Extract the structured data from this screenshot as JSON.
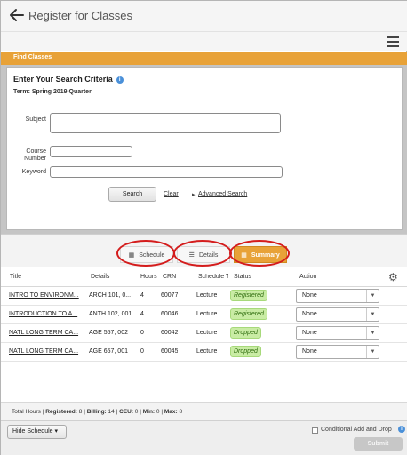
{
  "header": {
    "title": "Register for Classes"
  },
  "find_classes": {
    "label": "Find Classes"
  },
  "search": {
    "heading": "Enter Your Search Criteria",
    "term": "Term: Spring 2019 Quarter",
    "subject_label": "Subject",
    "course_label_1": "Course",
    "course_label_2": "Number",
    "keyword_label": "Keyword",
    "search_button": "Search",
    "clear_link": "Clear",
    "advanced_link": "Advanced Search"
  },
  "tabs": [
    {
      "label": "Schedule",
      "icon": "calendar-icon"
    },
    {
      "label": "Details",
      "icon": "list-icon"
    },
    {
      "label": "Summary",
      "icon": "calendar-icon",
      "active": true
    }
  ],
  "table": {
    "headers": [
      "Title",
      "Details",
      "Hours",
      "CRN",
      "Schedule Type",
      "Status",
      "Action"
    ],
    "rows": [
      {
        "title": "INTRO TO ENVIRONM...",
        "details": "ARCH 101, 0...",
        "hours": "4",
        "crn": "60077",
        "schedule": "Lecture",
        "status": "Registered",
        "action": "None"
      },
      {
        "title": "INTRODUCTION TO A...",
        "details": "ANTH 102, 001",
        "hours": "4",
        "crn": "60046",
        "schedule": "Lecture",
        "status": "Registered",
        "action": "None"
      },
      {
        "title": "NATL LONG TERM CA...",
        "details": "AGE 557, 002",
        "hours": "0",
        "crn": "60042",
        "schedule": "Lecture",
        "status": "Dropped",
        "action": "None"
      },
      {
        "title": "NATL LONG TERM CA...",
        "details": "AGE 657, 001",
        "hours": "0",
        "crn": "60045",
        "schedule": "Lecture",
        "status": "Dropped",
        "action": "None"
      }
    ]
  },
  "totals": {
    "hours_label": "Total Hours",
    "registered_label": "Registered:",
    "registered": "8",
    "billing_label": "Billing:",
    "billing": "14",
    "ceu_label": "CEU:",
    "ceu": "0",
    "min_label": "Min:",
    "min": "0",
    "max_label": "Max:",
    "max": "8"
  },
  "footer": {
    "hide_schedule": "Hide Schedule",
    "conditional_label": "Conditional Add and Drop",
    "submit": "Submit"
  },
  "colors": {
    "accent": "#e8a238",
    "status_badge": "#c9eca4",
    "annotation_circle": "#d41c1c"
  }
}
